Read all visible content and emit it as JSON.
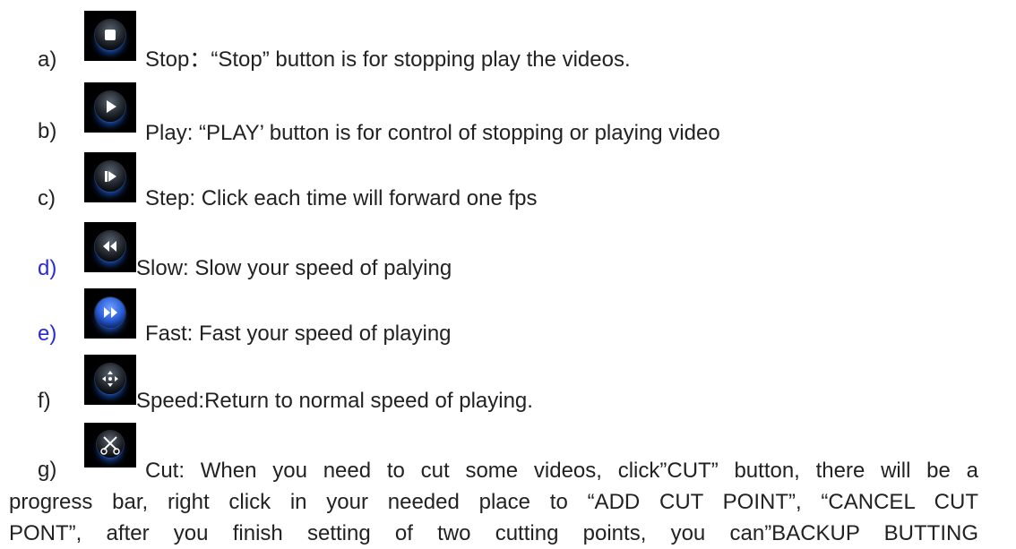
{
  "items": [
    {
      "marker": "a)",
      "text": "Stop：“Stop” button is for stopping play the videos.",
      "icon": "stop-icon"
    },
    {
      "marker": "b)",
      "text": "Play: “PLAY’ button is for control of stopping or playing video",
      "icon": "play-icon"
    },
    {
      "marker": "c)",
      "text": "Step: Click each time will forward one fps",
      "icon": "step-icon"
    },
    {
      "marker": "d)",
      "text": "Slow: Slow your speed of palying",
      "icon": "slow-icon"
    },
    {
      "marker": "e)",
      "text": "Fast: Fast your speed of playing",
      "icon": "fast-icon"
    },
    {
      "marker": "f)",
      "text": "Speed:Return to normal speed of playing.",
      "icon": "speed-icon"
    },
    {
      "marker": "g)",
      "icon": "cut-icon",
      "lines": [
        "Cut: When you need to cut some videos, click”CUT” button, there will be a",
        "progress bar, right click in your needed place to “ADD CUT POINT”, “CANCEL CUT",
        "PONT”, after you finish setting of two cutting points, you can”BACKUP BUTTING"
      ]
    }
  ],
  "colors": {
    "marker_default": "#222222",
    "marker_blue": "#2a2ad8",
    "icon_bg": "#000000",
    "icon_glow": "#1a4fb8"
  }
}
